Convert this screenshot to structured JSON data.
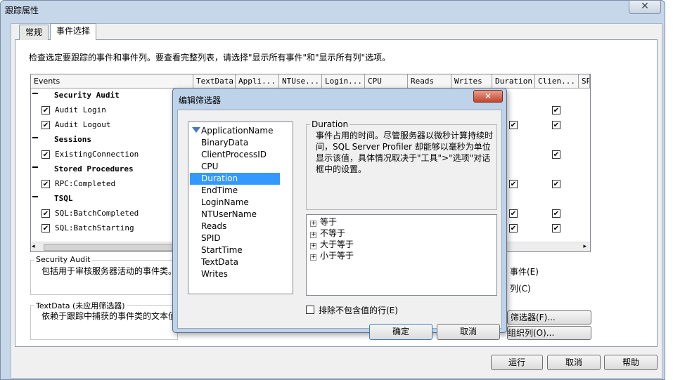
{
  "window": {
    "title": "跟踪属性",
    "close_glyph": "✕"
  },
  "tabs": [
    {
      "label": "常规"
    },
    {
      "label": "事件选择"
    }
  ],
  "instructions": "检查选定要跟踪的事件和事件列。要查看完整列表，请选择\"显示所有事件\"和\"显示所有列\"选项。",
  "grid": {
    "columns": [
      "Events",
      "TextData",
      "Appli...",
      "NTUse...",
      "Login...",
      "CPU",
      "Reads",
      "Writes",
      "Duration",
      "Clien...",
      "SP"
    ],
    "rows": [
      {
        "type": "category",
        "label": "Security Audit"
      },
      {
        "type": "event",
        "label": "Audit Login",
        "checked": true
      },
      {
        "type": "event",
        "label": "Audit Logout",
        "checked": true
      },
      {
        "type": "category",
        "label": "Sessions"
      },
      {
        "type": "event",
        "label": "ExistingConnection",
        "checked": true
      },
      {
        "type": "category",
        "label": "Stored Procedures"
      },
      {
        "type": "event",
        "label": "RPC:Completed",
        "checked": true
      },
      {
        "type": "category",
        "label": "TSQL"
      },
      {
        "type": "event",
        "label": "SQL:BatchCompleted",
        "checked": true
      },
      {
        "type": "event",
        "label": "SQL:BatchStarting",
        "checked": true
      }
    ],
    "scroll_left": "◂",
    "scroll_right": "▸"
  },
  "security_box": {
    "title": "Security Audit",
    "description": "包括用于审核服务器活动的事件类。"
  },
  "textdata_box": {
    "title": "TextData (未应用筛选器)",
    "description": "依赖于跟踪中捕获的事件类的文本值"
  },
  "options": {
    "show_all_events": "事件(E)",
    "show_all_columns": "列(C)"
  },
  "buttons": {
    "filter": "筛选器(F)...",
    "organize": "组织列(O)...",
    "run": "运行",
    "cancel": "取消",
    "help": "帮助"
  },
  "edit_filter": {
    "title": "编辑筛选器",
    "close_glyph": "✕",
    "columns": [
      "ApplicationName",
      "BinaryData",
      "ClientProcessID",
      "CPU",
      "Duration",
      "EndTime",
      "LoginName",
      "NTUserName",
      "Reads",
      "SPID",
      "StartTime",
      "TextData",
      "Writes"
    ],
    "selected_column": "Duration",
    "description_title": "Duration",
    "description_text": "事件占用的时间。尽管服务器以微秒计算持续时间，SQL Server Profiler 却能够以毫秒为单位显示该值，具体情况取决于\"工具\">\"选项\"对话框中的设置。",
    "operators": [
      "等于",
      "不等于",
      "大于等于",
      "小于等于"
    ],
    "plus_glyph": "+",
    "exclude_label": "排除不包含值的行(E)",
    "ok_label": "确定",
    "cancel_label": "取消"
  }
}
